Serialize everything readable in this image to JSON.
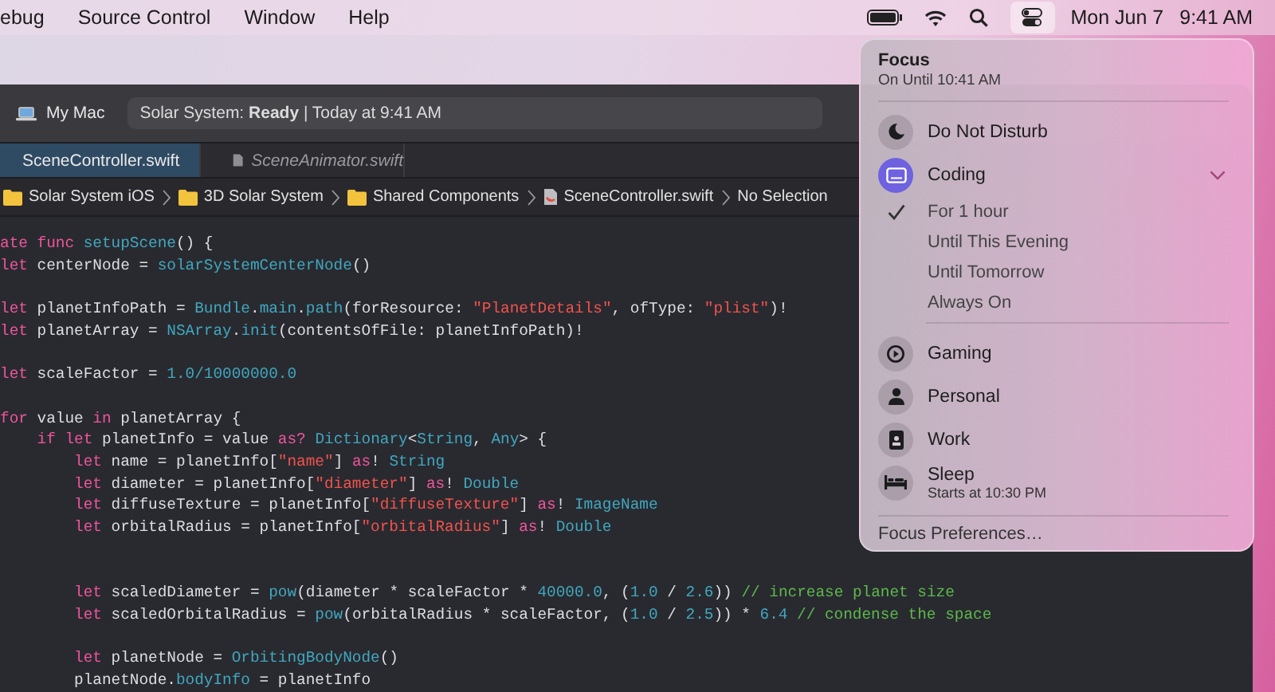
{
  "menu_bar": {
    "menus": [
      "ebug",
      "Source Control",
      "Window",
      "Help"
    ],
    "control_center_open": true,
    "date": "Mon Jun 7",
    "time": "9:41 AM"
  },
  "xcode": {
    "run_destination": "My Mac",
    "activity": "Solar System: **Ready** | Today at 9:41 AM",
    "tabs": [
      {
        "label": "SceneController.swift",
        "selected": true,
        "preview": false
      },
      {
        "label": "SceneAnimator.swift",
        "selected": false,
        "preview": true
      }
    ],
    "breadcrumbs": [
      {
        "label": "Solar System iOS",
        "kind": "folder"
      },
      {
        "label": "3D Solar System",
        "kind": "folder"
      },
      {
        "label": "Shared Components",
        "kind": "folder"
      },
      {
        "label": "SceneController.swift",
        "kind": "file"
      },
      {
        "label": "No Selection",
        "kind": "text"
      }
    ],
    "code_lines": [
      {
        "kind": "code",
        "tokens": [
          {
            "kind": "keyword",
            "text": "ate func"
          },
          {
            "kind": "symbol",
            "text": " setupScene"
          },
          {
            "kind": "plain",
            "text": "() {"
          }
        ]
      },
      {
        "kind": "code",
        "tokens": [
          {
            "kind": "keyword",
            "text": "let"
          },
          {
            "kind": "plain",
            "text": " centerNode = "
          },
          {
            "kind": "symbol",
            "text": "solarSystemCenterNode"
          },
          {
            "kind": "plain",
            "text": "()"
          }
        ]
      },
      {
        "kind": "blank"
      },
      {
        "kind": "code",
        "tokens": [
          {
            "kind": "keyword",
            "text": "let"
          },
          {
            "kind": "plain",
            "text": " planetInfoPath = "
          },
          {
            "kind": "symbol",
            "text": "Bundle"
          },
          {
            "kind": "plain",
            "text": "."
          },
          {
            "kind": "symbol",
            "text": "main"
          },
          {
            "kind": "plain",
            "text": "."
          },
          {
            "kind": "symbol",
            "text": "path"
          },
          {
            "kind": "plain",
            "text": "(forResource: "
          },
          {
            "kind": "string",
            "text": "\"PlanetDetails\""
          },
          {
            "kind": "plain",
            "text": ", ofType: "
          },
          {
            "kind": "string",
            "text": "\"plist\""
          },
          {
            "kind": "plain",
            "text": ")!"
          }
        ]
      },
      {
        "kind": "code",
        "tokens": [
          {
            "kind": "keyword",
            "text": "let"
          },
          {
            "kind": "plain",
            "text": " planetArray = "
          },
          {
            "kind": "symbol",
            "text": "NSArray"
          },
          {
            "kind": "plain",
            "text": "."
          },
          {
            "kind": "symbol",
            "text": "init"
          },
          {
            "kind": "plain",
            "text": "(contentsOfFile: planetInfoPath)!"
          }
        ]
      },
      {
        "kind": "blank"
      },
      {
        "kind": "code",
        "tokens": [
          {
            "kind": "keyword",
            "text": "let"
          },
          {
            "kind": "plain",
            "text": " scaleFactor = "
          },
          {
            "kind": "symbol",
            "text": "1.0/10000000.0"
          }
        ]
      },
      {
        "kind": "blank"
      },
      {
        "kind": "code",
        "tokens": [
          {
            "kind": "keyword",
            "text": "for"
          },
          {
            "kind": "plain",
            "text": " value "
          },
          {
            "kind": "keyword",
            "text": "in"
          },
          {
            "kind": "plain",
            "text": " planetArray {"
          }
        ]
      },
      {
        "kind": "code",
        "tokens": [
          {
            "kind": "keyword",
            "text": "    if let"
          },
          {
            "kind": "plain",
            "text": " planetInfo = value "
          },
          {
            "kind": "keyword",
            "text": "as?"
          },
          {
            "kind": "symbol",
            "text": " Dictionary"
          },
          {
            "kind": "plain",
            "text": "<"
          },
          {
            "kind": "symbol",
            "text": "String"
          },
          {
            "kind": "plain",
            "text": ", "
          },
          {
            "kind": "symbol",
            "text": "Any"
          },
          {
            "kind": "plain",
            "text": "> {"
          }
        ]
      },
      {
        "kind": "code",
        "tokens": [
          {
            "kind": "keyword",
            "text": "        let"
          },
          {
            "kind": "plain",
            "text": " name = planetInfo["
          },
          {
            "kind": "string",
            "text": "\"name\""
          },
          {
            "kind": "plain",
            "text": "] "
          },
          {
            "kind": "keyword",
            "text": "as"
          },
          {
            "kind": "plain",
            "text": "! "
          },
          {
            "kind": "symbol",
            "text": "String"
          }
        ]
      },
      {
        "kind": "code",
        "tokens": [
          {
            "kind": "keyword",
            "text": "        let"
          },
          {
            "kind": "plain",
            "text": " diameter = planetInfo["
          },
          {
            "kind": "string",
            "text": "\"diameter\""
          },
          {
            "kind": "plain",
            "text": "] "
          },
          {
            "kind": "keyword",
            "text": "as"
          },
          {
            "kind": "plain",
            "text": "! "
          },
          {
            "kind": "symbol",
            "text": "Double"
          }
        ]
      },
      {
        "kind": "code",
        "tokens": [
          {
            "kind": "keyword",
            "text": "        let"
          },
          {
            "kind": "plain",
            "text": " diffuseTexture = planetInfo["
          },
          {
            "kind": "string",
            "text": "\"diffuseTexture\""
          },
          {
            "kind": "plain",
            "text": "] "
          },
          {
            "kind": "keyword",
            "text": "as"
          },
          {
            "kind": "plain",
            "text": "! "
          },
          {
            "kind": "symbol",
            "text": "ImageName"
          }
        ]
      },
      {
        "kind": "code",
        "tokens": [
          {
            "kind": "keyword",
            "text": "        let"
          },
          {
            "kind": "plain",
            "text": " orbitalRadius = planetInfo["
          },
          {
            "kind": "string",
            "text": "\"orbitalRadius\""
          },
          {
            "kind": "plain",
            "text": "] "
          },
          {
            "kind": "keyword",
            "text": "as"
          },
          {
            "kind": "plain",
            "text": "! "
          },
          {
            "kind": "symbol",
            "text": "Double"
          }
        ]
      },
      {
        "kind": "blank"
      },
      {
        "kind": "blank"
      },
      {
        "kind": "code",
        "tokens": [
          {
            "kind": "keyword",
            "text": "        let"
          },
          {
            "kind": "plain",
            "text": " scaledDiameter = "
          },
          {
            "kind": "symbol",
            "text": "pow"
          },
          {
            "kind": "plain",
            "text": "(diameter * scaleFactor * "
          },
          {
            "kind": "symbol",
            "text": "40000.0"
          },
          {
            "kind": "plain",
            "text": ", ("
          },
          {
            "kind": "symbol",
            "text": "1.0"
          },
          {
            "kind": "plain",
            "text": " / "
          },
          {
            "kind": "symbol",
            "text": "2.6"
          },
          {
            "kind": "plain",
            "text": ")) "
          },
          {
            "kind": "comment",
            "text": "// increase planet size"
          }
        ]
      },
      {
        "kind": "code",
        "tokens": [
          {
            "kind": "keyword",
            "text": "        let"
          },
          {
            "kind": "plain",
            "text": " scaledOrbitalRadius = "
          },
          {
            "kind": "symbol",
            "text": "pow"
          },
          {
            "kind": "plain",
            "text": "(orbitalRadius * scaleFactor, ("
          },
          {
            "kind": "symbol",
            "text": "1.0"
          },
          {
            "kind": "plain",
            "text": " / "
          },
          {
            "kind": "symbol",
            "text": "2.5"
          },
          {
            "kind": "plain",
            "text": ")) * "
          },
          {
            "kind": "symbol",
            "text": "6.4"
          },
          {
            "kind": "comment",
            "text": " // condense the space"
          }
        ]
      },
      {
        "kind": "blank"
      },
      {
        "kind": "code",
        "tokens": [
          {
            "kind": "keyword",
            "text": "        let"
          },
          {
            "kind": "plain",
            "text": " planetNode = "
          },
          {
            "kind": "symbol",
            "text": "OrbitingBodyNode"
          },
          {
            "kind": "plain",
            "text": "()"
          }
        ]
      },
      {
        "kind": "code",
        "tokens": [
          {
            "kind": "plain",
            "text": "        planetNode."
          },
          {
            "kind": "symbol",
            "text": "bodyInfo"
          },
          {
            "kind": "plain",
            "text": " = planetInfo"
          }
        ]
      }
    ]
  },
  "focus_panel": {
    "title": "Focus",
    "subtitle": "On Until 10:41 AM",
    "modes": [
      {
        "name": "Do Not Disturb",
        "selected": false,
        "expanded": false
      },
      {
        "name": "Coding",
        "selected": true,
        "expanded": true,
        "options": [
          {
            "label": "For 1 hour",
            "checked": true
          },
          {
            "label": "Until This Evening",
            "checked": false
          },
          {
            "label": "Until Tomorrow",
            "checked": false
          },
          {
            "label": "Always On",
            "checked": false
          }
        ]
      },
      {
        "name": "Gaming",
        "selected": false,
        "expanded": false
      },
      {
        "name": "Personal",
        "selected": false,
        "expanded": false
      },
      {
        "name": "Work",
        "selected": false,
        "expanded": false
      },
      {
        "name": "Sleep",
        "selected": false,
        "expanded": false,
        "detail": "Starts at 10:30 PM"
      }
    ],
    "preferences": "Focus Preferences…"
  }
}
